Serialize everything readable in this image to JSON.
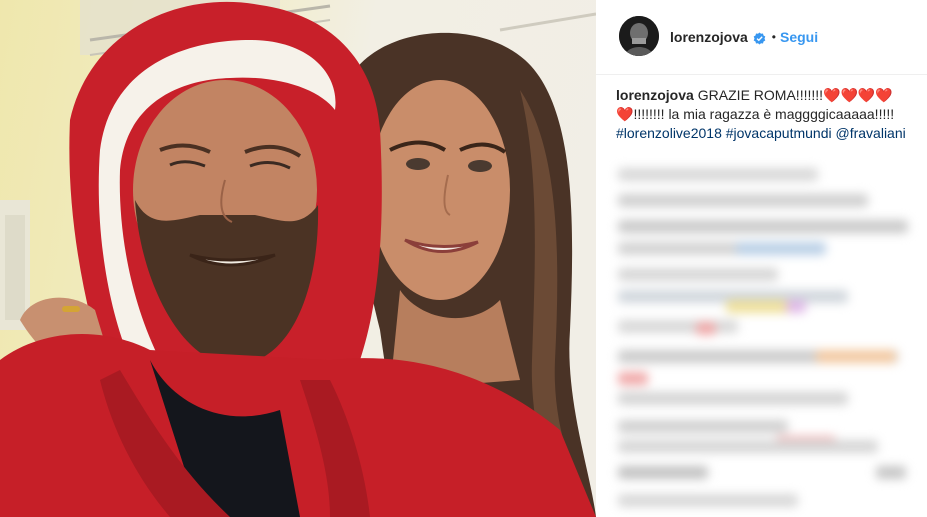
{
  "post": {
    "photo_alt": "Selfie of a bearded man in a red hooded robe with a smiling woman with long dark hair"
  },
  "header": {
    "username": "lorenzojova",
    "separator": "•",
    "follow_label": "Segui",
    "verified_icon": "verified-badge-icon"
  },
  "caption": {
    "username": "lorenzojova",
    "text_part1": "GRAZIE ROMA!!!!!!!",
    "hearts_part1": "❤️❤️❤️❤️",
    "hearts_part2": "❤️",
    "text_part2": "!!!!!!!! la mia ragazza è maggggicaaaaa!!!!! ",
    "hashtag1": "#lorenzolive2018",
    "hashtag2": "#jovacaputmundi",
    "mention": "@fravaliani"
  },
  "colors": {
    "accent": "#3897f0",
    "link": "#003569",
    "text": "#262626",
    "heart": "#ed4956"
  }
}
